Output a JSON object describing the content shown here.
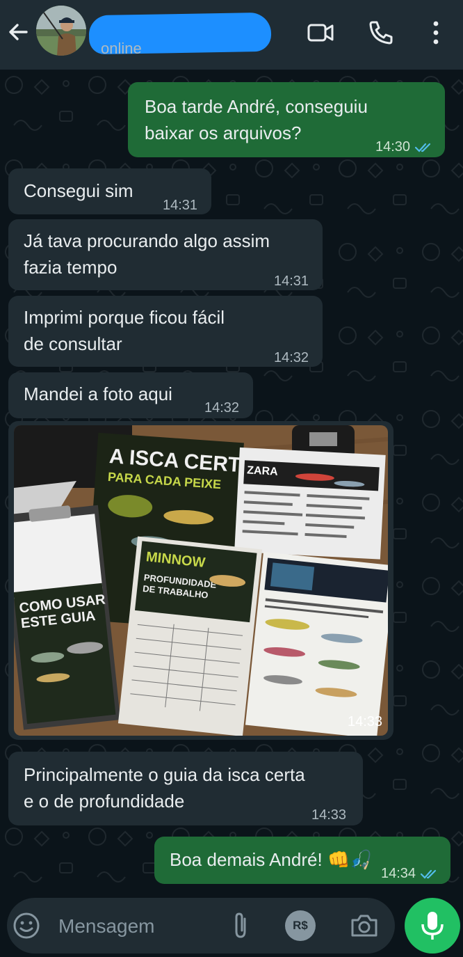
{
  "header": {
    "status": "online"
  },
  "composer": {
    "placeholder": "Mensagem",
    "currency_label": "R$"
  },
  "messages": [
    {
      "direction": "out",
      "text": "Boa tarde André, conseguiu\nbaixar os arquivos?",
      "time": "14:30",
      "read": true
    },
    {
      "direction": "in",
      "text": "Consegui sim",
      "time": "14:31"
    },
    {
      "direction": "in",
      "text": "Já tava procurando algo assim\nfazia tempo",
      "time": "14:31"
    },
    {
      "direction": "in",
      "text": "Imprimi porque ficou fácil\nde consultar",
      "time": "14:32"
    },
    {
      "direction": "in",
      "text": "Mandei a foto aqui",
      "time": "14:32"
    },
    {
      "direction": "in",
      "type": "image",
      "time": "14:33",
      "image_text": {
        "guide_title": "A ISCA CERTA",
        "guide_subtitle": "PARA CADA PEIXE",
        "how_to": "COMO USAR\nESTE GUIA",
        "minnow": "MINNOW",
        "depth": "PROFUNDIDADE\nDE TRABALHO",
        "zara": "ZARA"
      }
    },
    {
      "direction": "in",
      "text": "Principalmente o guia da isca certa\ne o de profundidade",
      "time": "14:33"
    },
    {
      "direction": "out",
      "text": "Boa demais André!",
      "emoji": "👊🎣",
      "time": "14:34",
      "read": true
    }
  ],
  "colors": {
    "header_bg": "#1f2c34",
    "chat_bg": "#0b141a",
    "incoming_bubble": "#202c33",
    "outgoing_bubble": "#1f6b37",
    "accent_green": "#21c063",
    "read_ticks": "#53bdeb",
    "name_redaction": "#1d8fff"
  },
  "icons": {
    "back": "arrow-left-icon",
    "video": "video-camera-icon",
    "call": "phone-icon",
    "menu": "kebab-menu-icon",
    "emoji": "smiley-icon",
    "attach": "paperclip-icon",
    "payment": "currency-icon",
    "camera": "camera-icon",
    "mic": "microphone-icon"
  }
}
